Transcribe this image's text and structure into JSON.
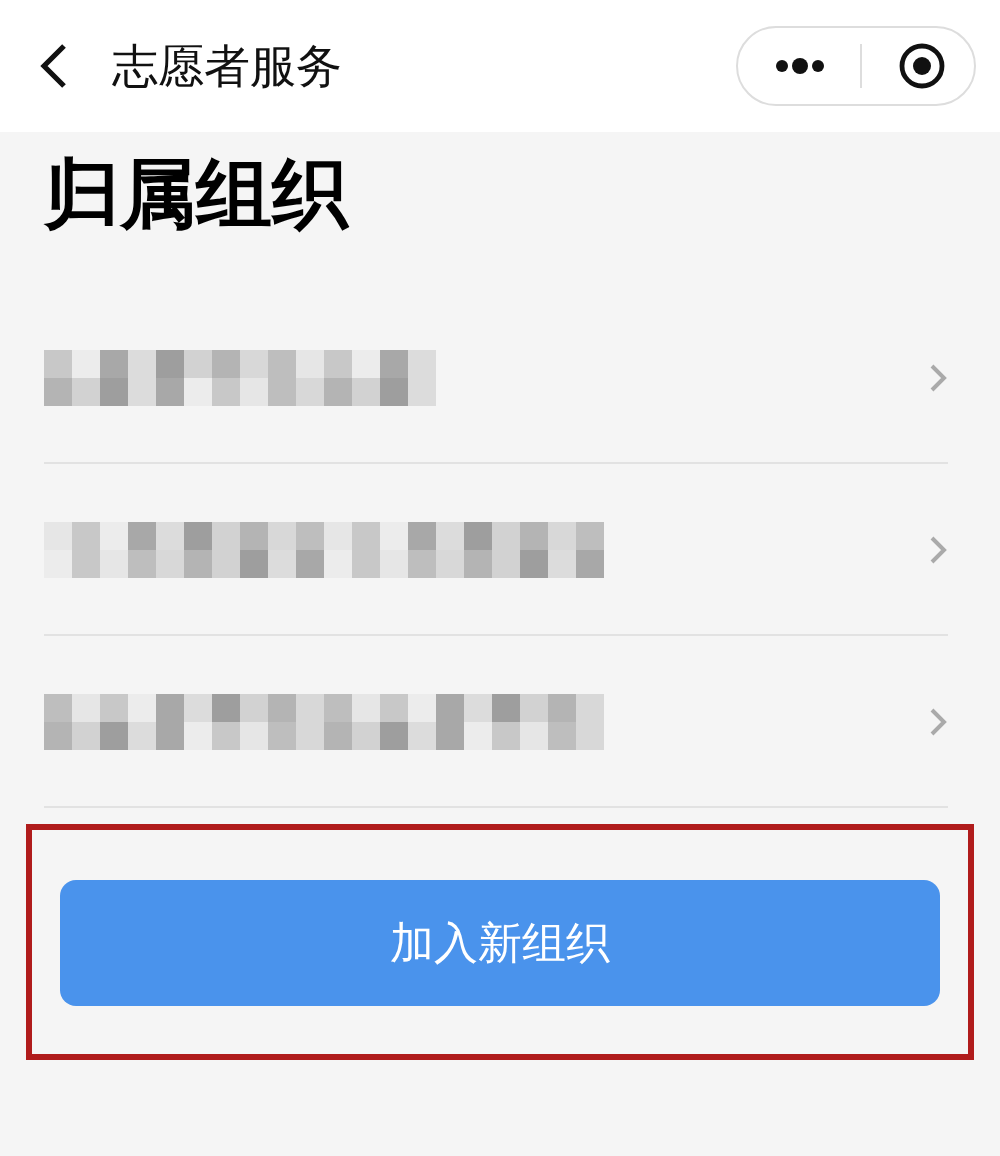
{
  "nav": {
    "title": "志愿者服务"
  },
  "heading": "归属组织",
  "organizations": [
    {
      "kind": "redacted"
    },
    {
      "kind": "redacted"
    },
    {
      "kind": "redacted"
    }
  ],
  "join_button": {
    "label": "加入新组织",
    "highlighted": true
  }
}
